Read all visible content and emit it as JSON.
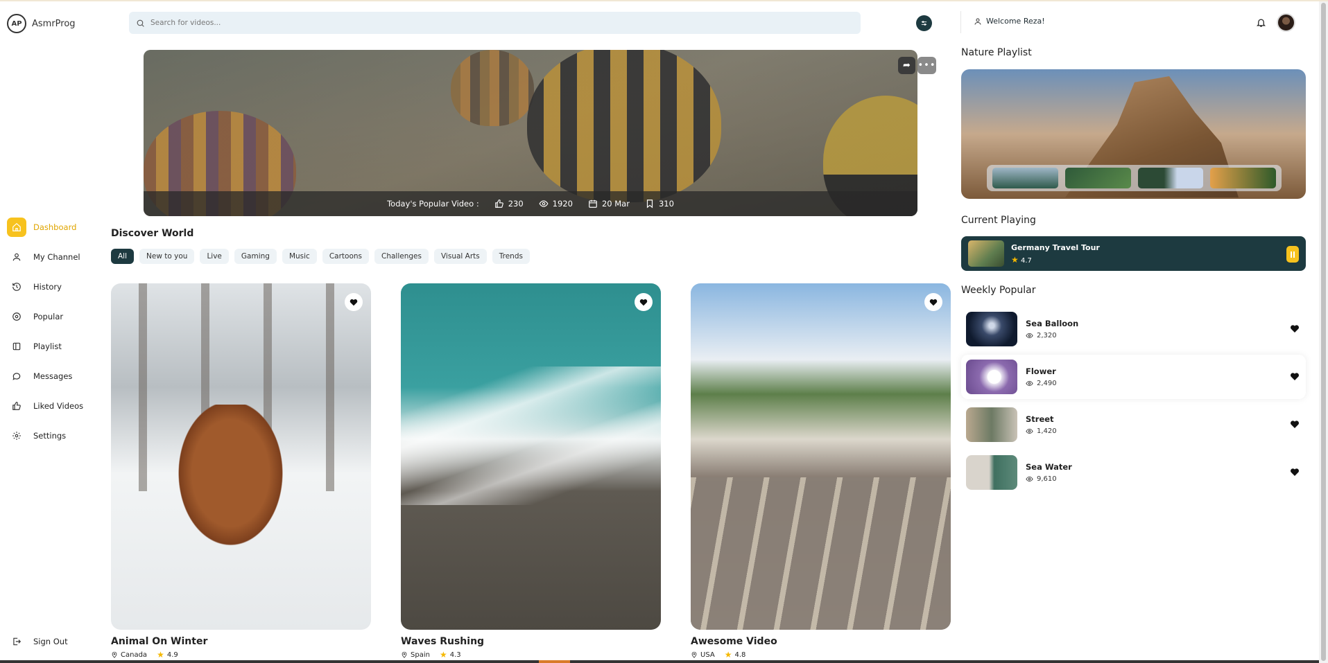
{
  "app": {
    "name": "AsmrProg",
    "logo_text": "AP"
  },
  "search": {
    "placeholder": "Search for videos..."
  },
  "user": {
    "welcome": "Welcome Reza!"
  },
  "sidebar": {
    "items": [
      {
        "label": "Dashboard",
        "icon": "home-icon",
        "active": true
      },
      {
        "label": "My Channel",
        "icon": "user-icon"
      },
      {
        "label": "History",
        "icon": "history-icon"
      },
      {
        "label": "Popular",
        "icon": "compass-icon"
      },
      {
        "label": "Playlist",
        "icon": "playlist-icon"
      },
      {
        "label": "Messages",
        "icon": "message-icon"
      },
      {
        "label": "Liked Videos",
        "icon": "thumbs-up-icon"
      },
      {
        "label": "Settings",
        "icon": "gear-icon"
      }
    ],
    "sign_out": "Sign Out"
  },
  "hero": {
    "label": "Today's Popular Video :",
    "likes": "230",
    "views": "1920",
    "date": "20 Mar",
    "saves": "310"
  },
  "discover": {
    "title": "Discover World",
    "chips": [
      "All",
      "New to you",
      "Live",
      "Gaming",
      "Music",
      "Cartoons",
      "Challenges",
      "Visual Arts",
      "Trends"
    ],
    "active_chip": "All"
  },
  "cards": [
    {
      "title": "Animal On Winter",
      "location": "Canada",
      "rating": "4.9"
    },
    {
      "title": "Waves Rushing",
      "location": "Spain",
      "rating": "4.3"
    },
    {
      "title": "Awesome Video",
      "location": "USA",
      "rating": "4.8"
    }
  ],
  "right": {
    "nature_playlist": "Nature Playlist",
    "current_playing_title": "Current Playing",
    "current": {
      "title": "Germany Travel Tour",
      "rating": "4.7"
    },
    "weekly_popular_title": "Weekly Popular",
    "weekly": [
      {
        "title": "Sea Balloon",
        "views": "2,320"
      },
      {
        "title": "Flower",
        "views": "2,490"
      },
      {
        "title": "Street",
        "views": "1,420"
      },
      {
        "title": "Sea Water",
        "views": "9,610"
      }
    ]
  },
  "colors": {
    "accent": "#f7c21e",
    "dark": "#1d3a40",
    "chip_bg": "#eef3f6",
    "search_bg": "#e9f1f6"
  }
}
